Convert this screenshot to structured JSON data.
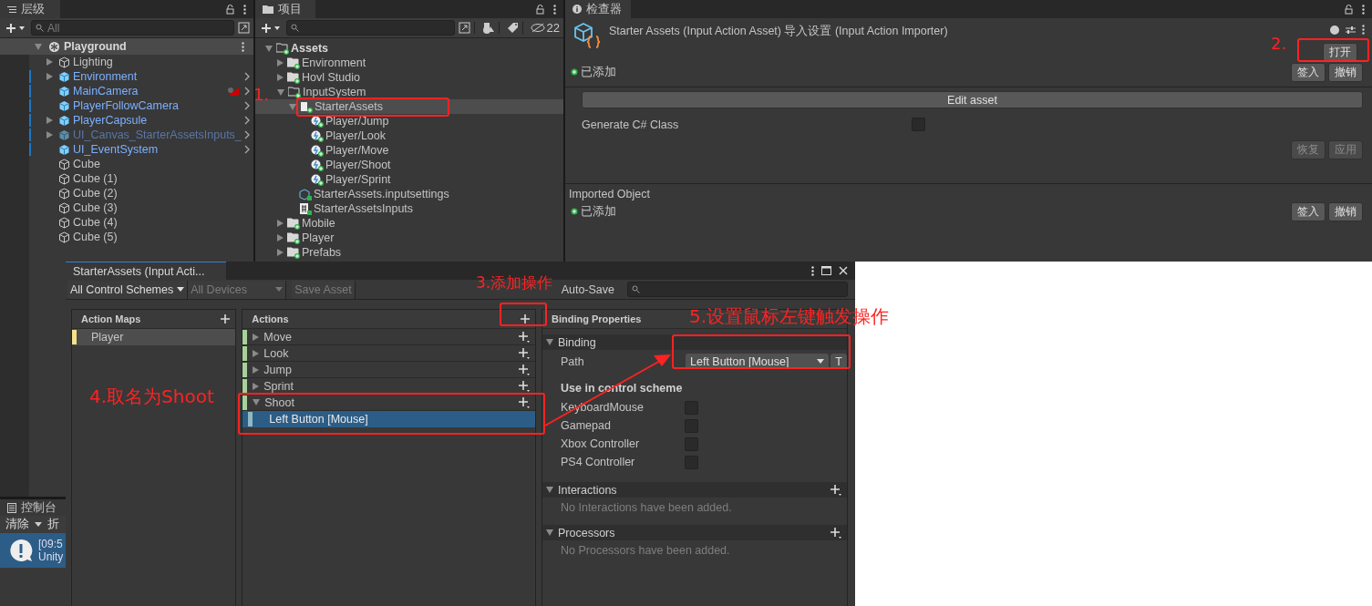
{
  "hierarchy": {
    "tab": "层级",
    "search": {
      "placeholder": "All"
    },
    "scene": {
      "name": "Playground",
      "expanded": true,
      "children": [
        {
          "name": "Lighting",
          "kind": "object",
          "has_children": true,
          "flagged": false
        },
        {
          "name": "Environment",
          "kind": "prefab",
          "has_children": true,
          "flagged": false
        },
        {
          "name": "MainCamera",
          "kind": "prefab",
          "has_children": false,
          "flagged": true
        },
        {
          "name": "PlayerFollowCamera",
          "kind": "prefab",
          "has_children": false,
          "flagged": false
        },
        {
          "name": "PlayerCapsule",
          "kind": "prefab",
          "has_children": true,
          "flagged": false
        },
        {
          "name": "UI_Canvas_StarterAssetsInputs_",
          "kind": "prefab_inactive",
          "has_children": true,
          "flagged": false
        },
        {
          "name": "UI_EventSystem",
          "kind": "prefab",
          "has_children": false,
          "flagged": false
        },
        {
          "name": "Cube",
          "kind": "object",
          "has_children": false,
          "flagged": false
        },
        {
          "name": "Cube (1)",
          "kind": "object",
          "has_children": false,
          "flagged": false
        },
        {
          "name": "Cube (2)",
          "kind": "object",
          "has_children": false,
          "flagged": false
        },
        {
          "name": "Cube (3)",
          "kind": "object",
          "has_children": false,
          "flagged": false
        },
        {
          "name": "Cube (4)",
          "kind": "object",
          "has_children": false,
          "flagged": false
        },
        {
          "name": "Cube (5)",
          "kind": "object",
          "has_children": false,
          "flagged": false
        }
      ]
    }
  },
  "project": {
    "tab": "项目",
    "hidden_count": "22",
    "tree": [
      {
        "name": "Assets",
        "kind": "folder_open",
        "expanded": true,
        "selected": false,
        "children": [
          {
            "name": "Environment",
            "kind": "folder",
            "expanded": false,
            "selected": false
          },
          {
            "name": "Hovl Studio",
            "kind": "folder",
            "expanded": false,
            "selected": false
          },
          {
            "name": "InputSystem",
            "kind": "folder_open",
            "expanded": true,
            "selected": false,
            "children": [
              {
                "name": "StarterAssets",
                "kind": "asset",
                "expanded": true,
                "selected": true,
                "children": [
                  {
                    "name": "Player/Jump",
                    "kind": "action",
                    "selected": false
                  },
                  {
                    "name": "Player/Look",
                    "kind": "action",
                    "selected": false
                  },
                  {
                    "name": "Player/Move",
                    "kind": "action",
                    "selected": false
                  },
                  {
                    "name": "Player/Shoot",
                    "kind": "action",
                    "selected": false
                  },
                  {
                    "name": "Player/Sprint",
                    "kind": "action",
                    "selected": false
                  }
                ]
              },
              {
                "name": "StarterAssets.inputsettings",
                "kind": "settings",
                "selected": false
              },
              {
                "name": "StarterAssetsInputs",
                "kind": "script",
                "selected": false
              }
            ]
          },
          {
            "name": "Mobile",
            "kind": "folder",
            "expanded": false,
            "selected": false
          },
          {
            "name": "Player",
            "kind": "folder",
            "expanded": false,
            "selected": false
          },
          {
            "name": "Prefabs",
            "kind": "folder",
            "expanded": false,
            "selected": false
          }
        ]
      }
    ]
  },
  "inspector": {
    "tab": "检查器",
    "title": "Starter Assets (Input Action Asset) 导入设置 (Input Action Importer)",
    "open_button": "打开",
    "status": "已添加",
    "checkin": "签入",
    "revert": "撤销",
    "edit_button": "Edit asset",
    "generate_label": "Generate C# Class",
    "generate_checked": false,
    "reset_button": {
      "label": "恢复",
      "disabled": true
    },
    "apply_button": {
      "label": "应用",
      "disabled": true
    },
    "imported": {
      "title": "Imported Object",
      "status": "已添加",
      "checkin": "签入",
      "revert": "撤销"
    }
  },
  "console": {
    "tab": "控制台",
    "clear": "清除",
    "collapse": "折",
    "log": {
      "time": "[09:5",
      "text": "Unity"
    }
  },
  "actions_window": {
    "tab": "StarterAssets (Input Acti...",
    "schemes": "All Control Schemes",
    "devices": "All Devices",
    "save": "Save Asset",
    "auto_save": "Auto-Save",
    "maps": {
      "title": "Action Maps",
      "items": [
        {
          "name": "Player",
          "selected": true
        }
      ]
    },
    "actions": {
      "title": "Actions",
      "items": [
        {
          "name": "Move",
          "expanded": false
        },
        {
          "name": "Look",
          "expanded": false
        },
        {
          "name": "Jump",
          "expanded": false
        },
        {
          "name": "Sprint",
          "expanded": false
        },
        {
          "name": "Shoot",
          "expanded": true,
          "bindings": [
            {
              "name": "Left Button [Mouse]",
              "selected": true
            }
          ]
        }
      ]
    },
    "properties": {
      "title": "Binding Properties",
      "binding": "Binding",
      "path_label": "Path",
      "path_value": "Left Button [Mouse]",
      "t_button": "T",
      "scheme_title": "Use in control scheme",
      "schemes": [
        {
          "name": "KeyboardMouse",
          "checked": false
        },
        {
          "name": "Gamepad",
          "checked": false
        },
        {
          "name": "Xbox Controller",
          "checked": false
        },
        {
          "name": "PS4 Controller",
          "checked": false
        }
      ],
      "interactions": {
        "title": "Interactions",
        "empty": "No Interactions have been added."
      },
      "processors": {
        "title": "Processors",
        "empty": "No Processors have been added."
      }
    }
  },
  "annotations": [
    {
      "label": "1."
    },
    {
      "label": "2."
    },
    {
      "label": "3.添加操作"
    },
    {
      "label": "4.取名为Shoot"
    },
    {
      "label": "5.设置鼠标左键触发操作"
    }
  ]
}
